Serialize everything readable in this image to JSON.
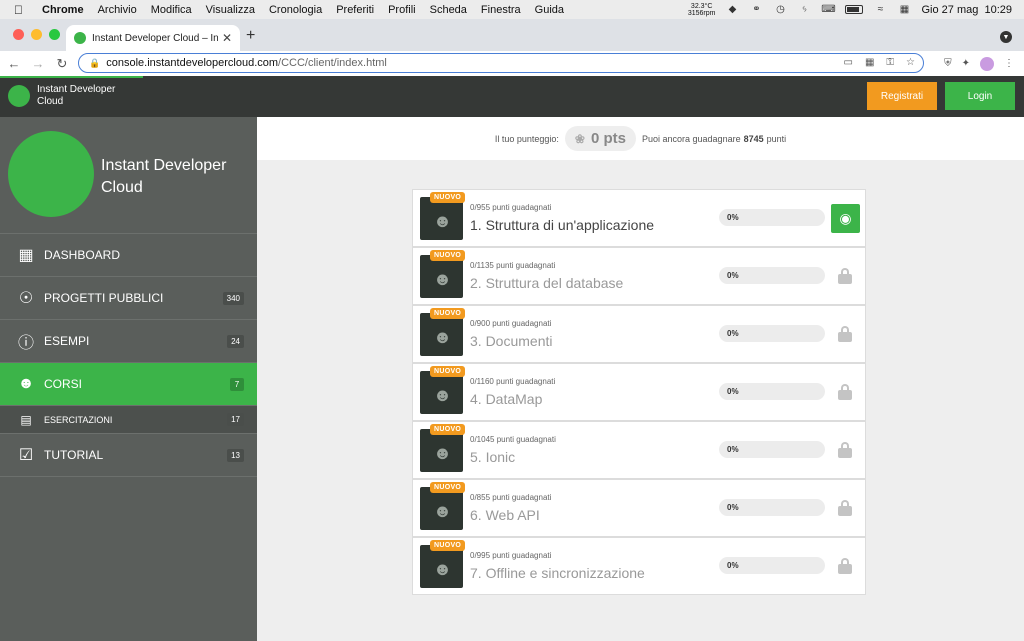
{
  "os_menubar": {
    "app": "Chrome",
    "items": [
      "Archivio",
      "Modifica",
      "Visualizza",
      "Cronologia",
      "Preferiti",
      "Profili",
      "Scheda",
      "Finestra",
      "Guida"
    ],
    "temp": "32.3°C",
    "rpm": "3156rpm",
    "clock": "Gio 27 mag  10:29"
  },
  "browser": {
    "tab_title": "Instant Developer Cloud – Insta",
    "url_host": "console.instantdevelopercloud.com",
    "url_path": "/CCC/client/index.html"
  },
  "header": {
    "app_name": "Instant Developer Cloud",
    "register_label": "Registrati",
    "login_label": "Login"
  },
  "sidebar": {
    "brand": "Instant Developer Cloud",
    "items": [
      {
        "label": "DASHBOARD",
        "icon": "grid-icon",
        "count": ""
      },
      {
        "label": "PROGETTI PUBBLICI",
        "icon": "globe-icon",
        "count": "340"
      },
      {
        "label": "ESEMPI",
        "icon": "info-icon",
        "count": "24"
      },
      {
        "label": "CORSI",
        "icon": "graduate-icon",
        "count": "7"
      },
      {
        "label": "ESERCITAZIONI",
        "icon": "exercise-icon",
        "count": "17"
      },
      {
        "label": "TUTORIAL",
        "icon": "tutorial-icon",
        "count": "13"
      }
    ]
  },
  "score": {
    "label": "Il tuo punteggio:",
    "points": "0 pts",
    "remaining_prefix": "Puoi ancora guadagnare",
    "remaining_value": "8745",
    "remaining_suffix": "punti"
  },
  "courses": [
    {
      "badge": "NUOVO",
      "earned": "0/955 punti guadagnati",
      "title": "1. Struttura di un'applicazione",
      "progress": "0%",
      "progress_value": 0,
      "locked": false
    },
    {
      "badge": "NUOVO",
      "earned": "0/1135 punti guadagnati",
      "title": "2. Struttura del database",
      "progress": "0%",
      "progress_value": 0,
      "locked": true
    },
    {
      "badge": "NUOVO",
      "earned": "0/900 punti guadagnati",
      "title": "3. Documenti",
      "progress": "0%",
      "progress_value": 0,
      "locked": true
    },
    {
      "badge": "NUOVO",
      "earned": "0/1160 punti guadagnati",
      "title": "4. DataMap",
      "progress": "0%",
      "progress_value": 0,
      "locked": true
    },
    {
      "badge": "NUOVO",
      "earned": "0/1045 punti guadagnati",
      "title": "5. Ionic",
      "progress": "0%",
      "progress_value": 0,
      "locked": true
    },
    {
      "badge": "NUOVO",
      "earned": "0/855 punti guadagnati",
      "title": "6. Web API",
      "progress": "0%",
      "progress_value": 0,
      "locked": true
    },
    {
      "badge": "NUOVO",
      "earned": "0/995 punti guadagnati",
      "title": "7. Offline e sincronizzazione",
      "progress": "0%",
      "progress_value": 0,
      "locked": true
    }
  ],
  "colors": {
    "accent": "#3cb449",
    "orange": "#f29a1f",
    "dark": "#353836",
    "sidebar": "#5a5e5b"
  }
}
